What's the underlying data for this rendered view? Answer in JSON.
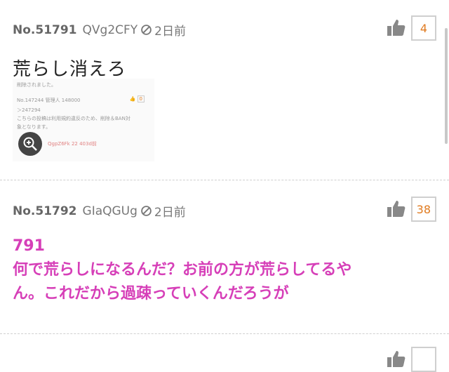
{
  "posts": [
    {
      "number": "No.51791",
      "user_id": "QVg2CFY",
      "time": "2日前",
      "likes": "4",
      "text": "荒らし消えろ",
      "attachment": {
        "lines": [
          "削除されました。",
          "No.147244 管理人 148000",
          "＞247294",
          "こちらの投稿は利用規約違反のため、削除＆BAN対",
          "象となります。",
          "QgpZ6Fk 22 403d前"
        ],
        "mini_like": "0"
      }
    },
    {
      "number": "No.51792",
      "user_id": "GIaQGUg",
      "time": "2日前",
      "likes": "38",
      "reply_ref": "791",
      "reply_lines": [
        "何で荒らしになるんだ？お前の方が荒らしてるや",
        "ん。これだから過疎っていくんだろうが"
      ]
    }
  ],
  "colors": {
    "accent_orange": "#e07a1f",
    "reply_magenta": "#d63fb8"
  },
  "icons": [
    "ban-icon",
    "thumbs-up-icon",
    "zoom-in-icon"
  ]
}
